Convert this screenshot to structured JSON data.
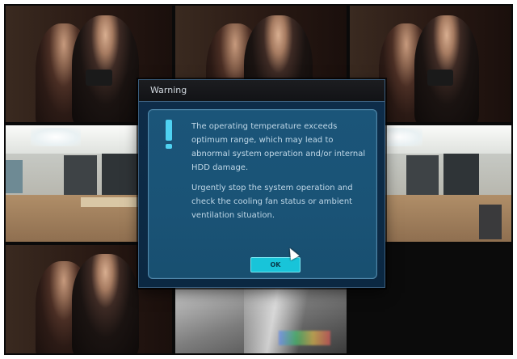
{
  "dialog": {
    "title": "Warning",
    "message_p1": "The operating temperature exceeds optimum range, which may lead to abnormal system operation and/or internal HDD damage.",
    "message_p2": "Urgently stop the system operation and check the cooling fan status or ambient ventilation situation.",
    "ok_label": "OK"
  },
  "icons": {
    "warning": "exclamation-icon",
    "pointer": "mouse-cursor-icon"
  },
  "colors": {
    "dialog_bg": "#0b2842",
    "panel_bg": "#1a5376",
    "accent": "#18c4d9"
  }
}
